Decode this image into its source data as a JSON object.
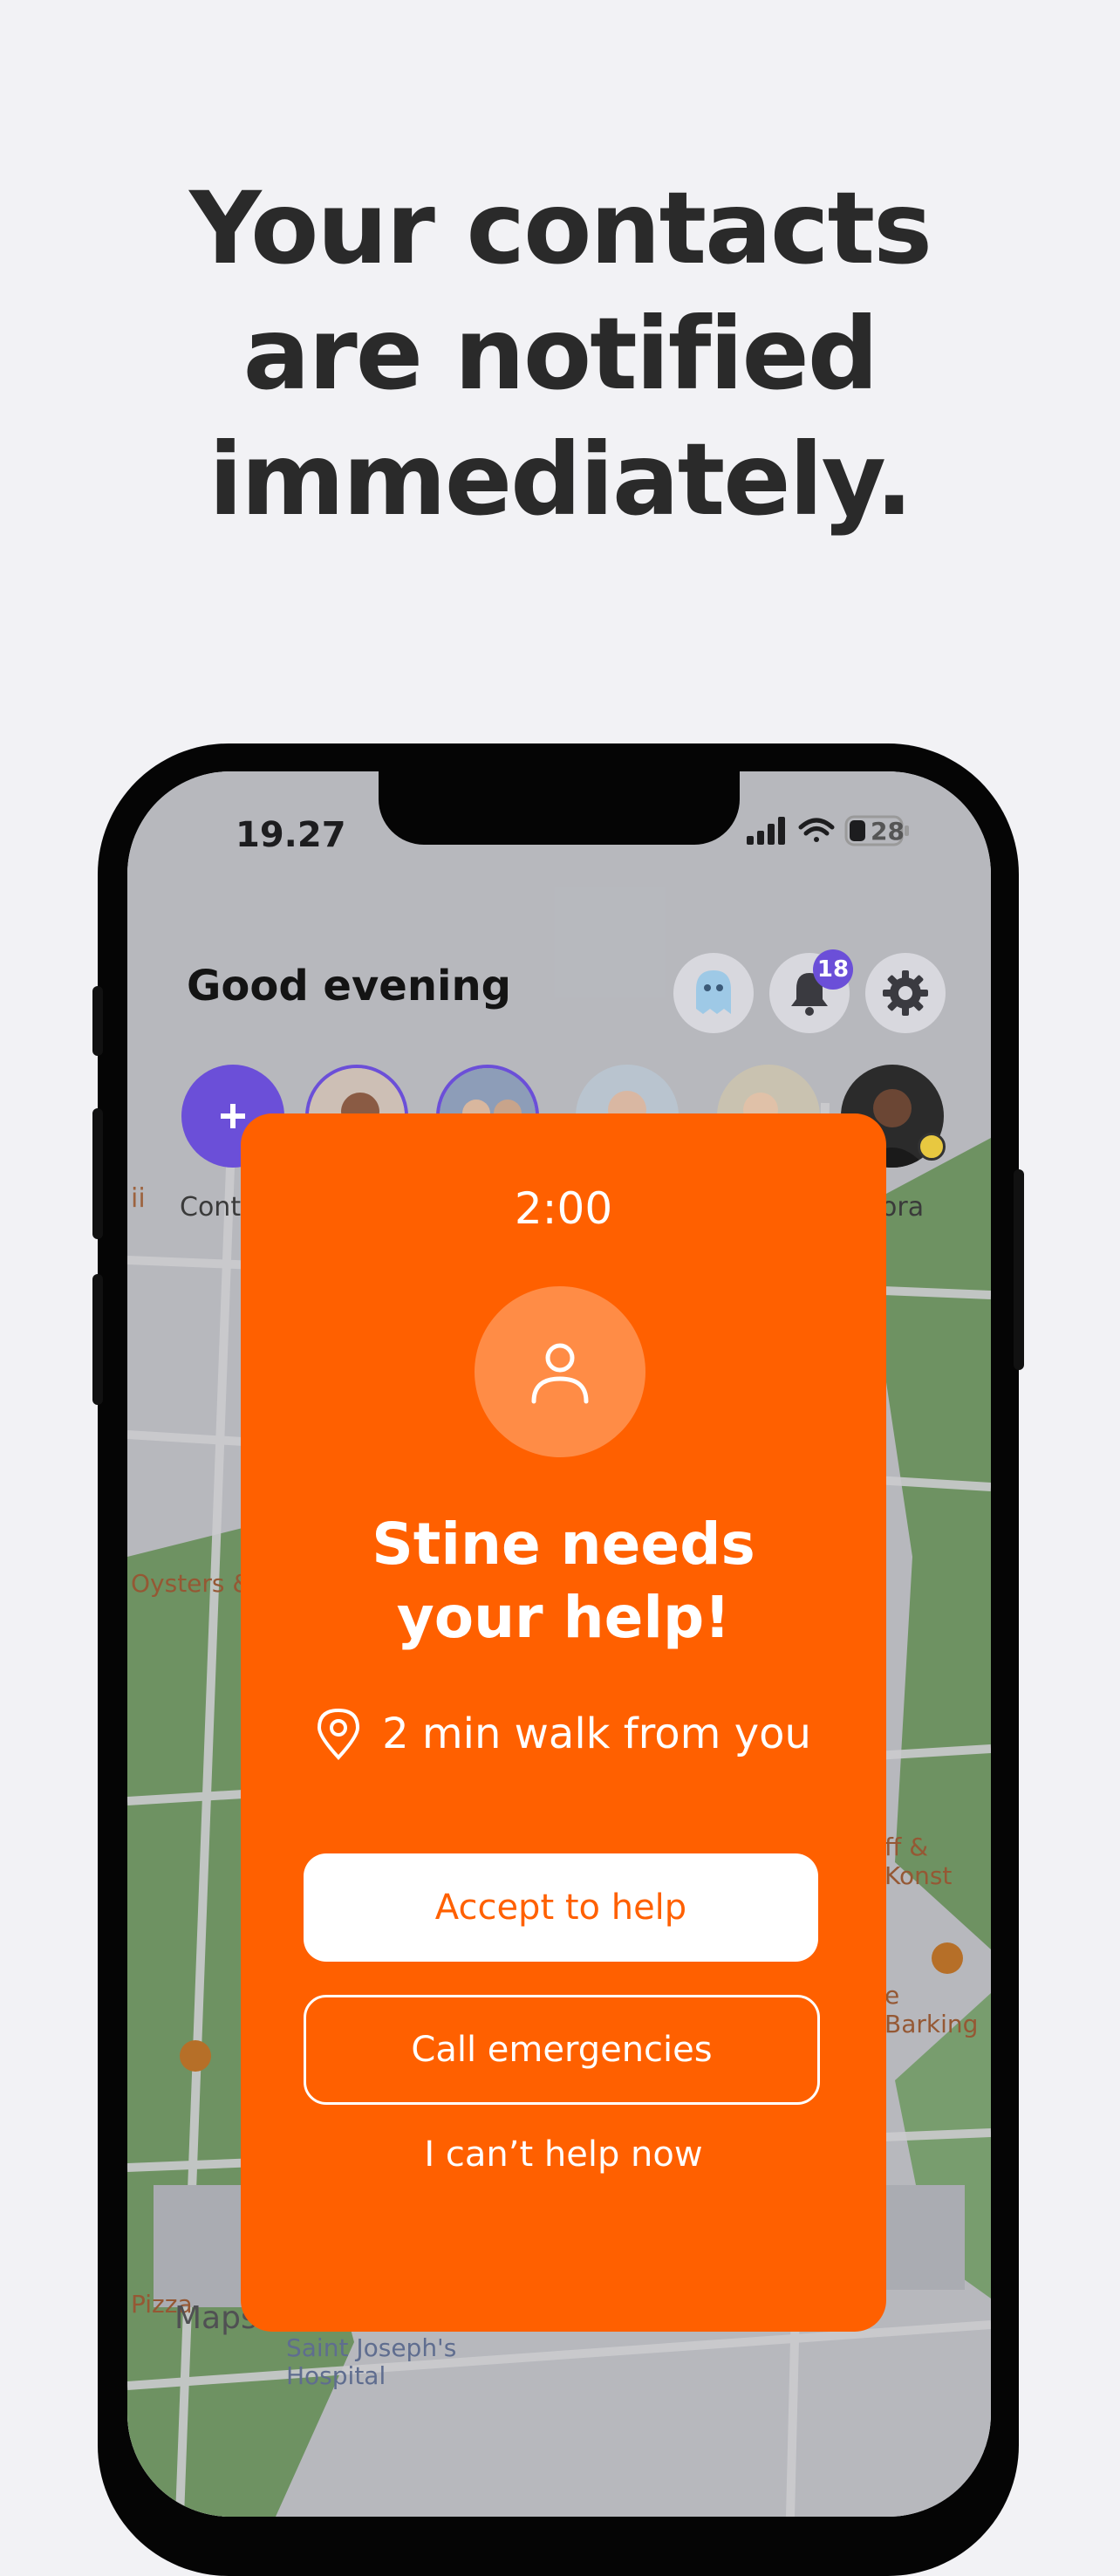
{
  "headline": {
    "line1": "Your contacts",
    "line2": "are notified",
    "line3": "immediately."
  },
  "status_bar": {
    "time": "19.27",
    "battery": "28"
  },
  "home": {
    "greeting": "Good evening",
    "notifications_count": "18",
    "add_contact_label": "Conta",
    "last_contact_label": "ora"
  },
  "map_labels": {
    "poi_left": "Oysters &",
    "poi_right_1": "ff & Konst",
    "poi_right_2": "e Barking",
    "poi_pizza": "Pizza",
    "hospital_line1": "Saint Joseph's",
    "hospital_line2": "Hospital",
    "maps_brand": "Maps",
    "partial_left": "ii"
  },
  "alert": {
    "timer": "2:00",
    "title_line1": "Stine needs",
    "title_line2": "your help!",
    "distance": "2 min walk from you",
    "accept_label": "Accept to help",
    "call_label": "Call emergencies",
    "decline_label": "I can’t help now"
  },
  "colors": {
    "accent": "#ff6000",
    "purple": "#6b4fd8"
  }
}
